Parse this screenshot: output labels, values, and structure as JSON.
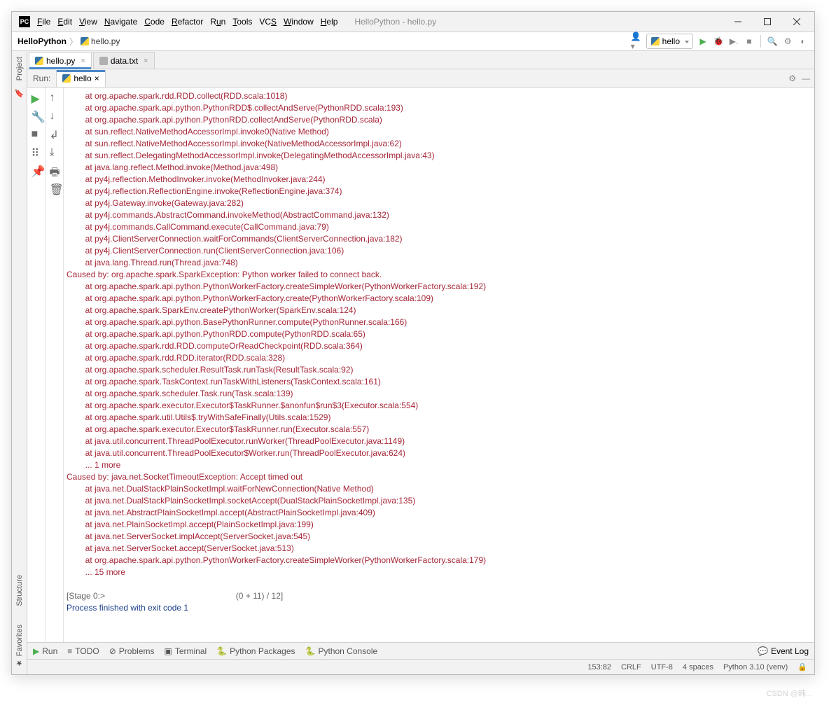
{
  "title": "HelloPython - hello.py",
  "menu": [
    "File",
    "Edit",
    "View",
    "Navigate",
    "Code",
    "Refactor",
    "Run",
    "Tools",
    "VCS",
    "Window",
    "Help"
  ],
  "breadcrumb": {
    "project": "HelloPython",
    "file": "hello.py"
  },
  "run_config": "hello",
  "editor_tabs": [
    {
      "label": "hello.py",
      "active": true
    },
    {
      "label": "data.txt",
      "active": false
    }
  ],
  "run": {
    "label": "Run:",
    "tab": "hello"
  },
  "left_tabs": {
    "project": "Project",
    "structure": "Structure",
    "favorites": "Favorites"
  },
  "console_lines": [
    {
      "c": "err",
      "t": "        at org.apache.spark.rdd.RDD.collect(RDD.scala:1018)"
    },
    {
      "c": "err",
      "t": "        at org.apache.spark.api.python.PythonRDD$.collectAndServe(PythonRDD.scala:193)"
    },
    {
      "c": "err",
      "t": "        at org.apache.spark.api.python.PythonRDD.collectAndServe(PythonRDD.scala)"
    },
    {
      "c": "err",
      "t": "        at sun.reflect.NativeMethodAccessorImpl.invoke0(Native Method)"
    },
    {
      "c": "err",
      "t": "        at sun.reflect.NativeMethodAccessorImpl.invoke(NativeMethodAccessorImpl.java:62)"
    },
    {
      "c": "err",
      "t": "        at sun.reflect.DelegatingMethodAccessorImpl.invoke(DelegatingMethodAccessorImpl.java:43)"
    },
    {
      "c": "err",
      "t": "        at java.lang.reflect.Method.invoke(Method.java:498)"
    },
    {
      "c": "err",
      "t": "        at py4j.reflection.MethodInvoker.invoke(MethodInvoker.java:244)"
    },
    {
      "c": "err",
      "t": "        at py4j.reflection.ReflectionEngine.invoke(ReflectionEngine.java:374)"
    },
    {
      "c": "err",
      "t": "        at py4j.Gateway.invoke(Gateway.java:282)"
    },
    {
      "c": "err",
      "t": "        at py4j.commands.AbstractCommand.invokeMethod(AbstractCommand.java:132)"
    },
    {
      "c": "err",
      "t": "        at py4j.commands.CallCommand.execute(CallCommand.java:79)"
    },
    {
      "c": "err",
      "t": "        at py4j.ClientServerConnection.waitForCommands(ClientServerConnection.java:182)"
    },
    {
      "c": "err",
      "t": "        at py4j.ClientServerConnection.run(ClientServerConnection.java:106)"
    },
    {
      "c": "err",
      "t": "        at java.lang.Thread.run(Thread.java:748)"
    },
    {
      "c": "err",
      "t": "Caused by: org.apache.spark.SparkException: Python worker failed to connect back."
    },
    {
      "c": "err",
      "t": "        at org.apache.spark.api.python.PythonWorkerFactory.createSimpleWorker(PythonWorkerFactory.scala:192)"
    },
    {
      "c": "err",
      "t": "        at org.apache.spark.api.python.PythonWorkerFactory.create(PythonWorkerFactory.scala:109)"
    },
    {
      "c": "err",
      "t": "        at org.apache.spark.SparkEnv.createPythonWorker(SparkEnv.scala:124)"
    },
    {
      "c": "err",
      "t": "        at org.apache.spark.api.python.BasePythonRunner.compute(PythonRunner.scala:166)"
    },
    {
      "c": "err",
      "t": "        at org.apache.spark.api.python.PythonRDD.compute(PythonRDD.scala:65)"
    },
    {
      "c": "err",
      "t": "        at org.apache.spark.rdd.RDD.computeOrReadCheckpoint(RDD.scala:364)"
    },
    {
      "c": "err",
      "t": "        at org.apache.spark.rdd.RDD.iterator(RDD.scala:328)"
    },
    {
      "c": "err",
      "t": "        at org.apache.spark.scheduler.ResultTask.runTask(ResultTask.scala:92)"
    },
    {
      "c": "err",
      "t": "        at org.apache.spark.TaskContext.runTaskWithListeners(TaskContext.scala:161)"
    },
    {
      "c": "err",
      "t": "        at org.apache.spark.scheduler.Task.run(Task.scala:139)"
    },
    {
      "c": "err",
      "t": "        at org.apache.spark.executor.Executor$TaskRunner.$anonfun$run$3(Executor.scala:554)"
    },
    {
      "c": "err",
      "t": "        at org.apache.spark.util.Utils$.tryWithSafeFinally(Utils.scala:1529)"
    },
    {
      "c": "err",
      "t": "        at org.apache.spark.executor.Executor$TaskRunner.run(Executor.scala:557)"
    },
    {
      "c": "err",
      "t": "        at java.util.concurrent.ThreadPoolExecutor.runWorker(ThreadPoolExecutor.java:1149)"
    },
    {
      "c": "err",
      "t": "        at java.util.concurrent.ThreadPoolExecutor$Worker.run(ThreadPoolExecutor.java:624)"
    },
    {
      "c": "err",
      "t": "        ... 1 more"
    },
    {
      "c": "err",
      "t": "Caused by: java.net.SocketTimeoutException: Accept timed out"
    },
    {
      "c": "err",
      "t": "        at java.net.DualStackPlainSocketImpl.waitForNewConnection(Native Method)"
    },
    {
      "c": "err",
      "t": "        at java.net.DualStackPlainSocketImpl.socketAccept(DualStackPlainSocketImpl.java:135)"
    },
    {
      "c": "err",
      "t": "        at java.net.AbstractPlainSocketImpl.accept(AbstractPlainSocketImpl.java:409)"
    },
    {
      "c": "err",
      "t": "        at java.net.PlainSocketImpl.accept(PlainSocketImpl.java:199)"
    },
    {
      "c": "err",
      "t": "        at java.net.ServerSocket.implAccept(ServerSocket.java:545)"
    },
    {
      "c": "err",
      "t": "        at java.net.ServerSocket.accept(ServerSocket.java:513)"
    },
    {
      "c": "err",
      "t": "        at org.apache.spark.api.python.PythonWorkerFactory.createSimpleWorker(PythonWorkerFactory.scala:179)"
    },
    {
      "c": "err",
      "t": "        ... 15 more"
    },
    {
      "c": "",
      "t": ""
    },
    {
      "c": "gray",
      "t": "[Stage 0:>                                                        (0 + 11) / 12]"
    },
    {
      "c": "blue",
      "t": "Process finished with exit code 1"
    }
  ],
  "bottom_tools": {
    "run": "Run",
    "todo": "TODO",
    "problems": "Problems",
    "terminal": "Terminal",
    "packages": "Python Packages",
    "console": "Python Console",
    "eventlog": "Event Log"
  },
  "status": {
    "pos": "153:82",
    "sep": "CRLF",
    "enc": "UTF-8",
    "indent": "4 spaces",
    "interp": "Python 3.10 (venv)"
  },
  "watermark": "CSDN @韩..."
}
